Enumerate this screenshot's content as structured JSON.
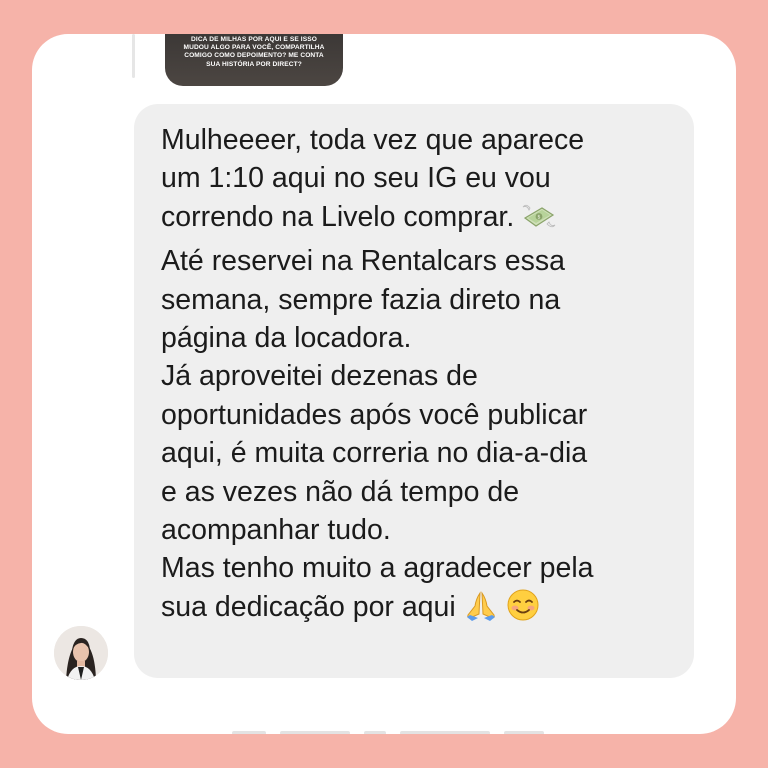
{
  "story_reply": {
    "thumbnail_text": "DICA DE MILHAS POR AQUI E SE ISSO MUDOU ALGO PARA VOCÊ, COMPARTILHA COMIGO COMO DEPOIMENTO? ME CONTA SUA HISTÓRIA POR DIRECT?"
  },
  "message": {
    "lines": [
      "Mulheeeer, toda vez que aparece",
      "um 1:10 aqui no seu IG eu vou",
      "correndo na Livelo comprar.",
      "Até reservei na Rentalcars essa",
      "semana, sempre fazia direto na",
      "página da locadora.",
      "Já aproveitei dezenas de",
      "oportunidades após você publicar",
      "aqui, é muita correria no dia-a-dia",
      "e as vezes não dá tempo de",
      "acompanhar tudo.",
      "Mas tenho muito a agradecer pela",
      "sua dedicação por aqui"
    ],
    "emojis": [
      "money-with-wings",
      "folded-hands",
      "smiling-face"
    ]
  },
  "colors": {
    "background": "#f6b3a9",
    "card": "#ffffff",
    "bubble": "#efefef",
    "text": "#1b1b1b"
  }
}
